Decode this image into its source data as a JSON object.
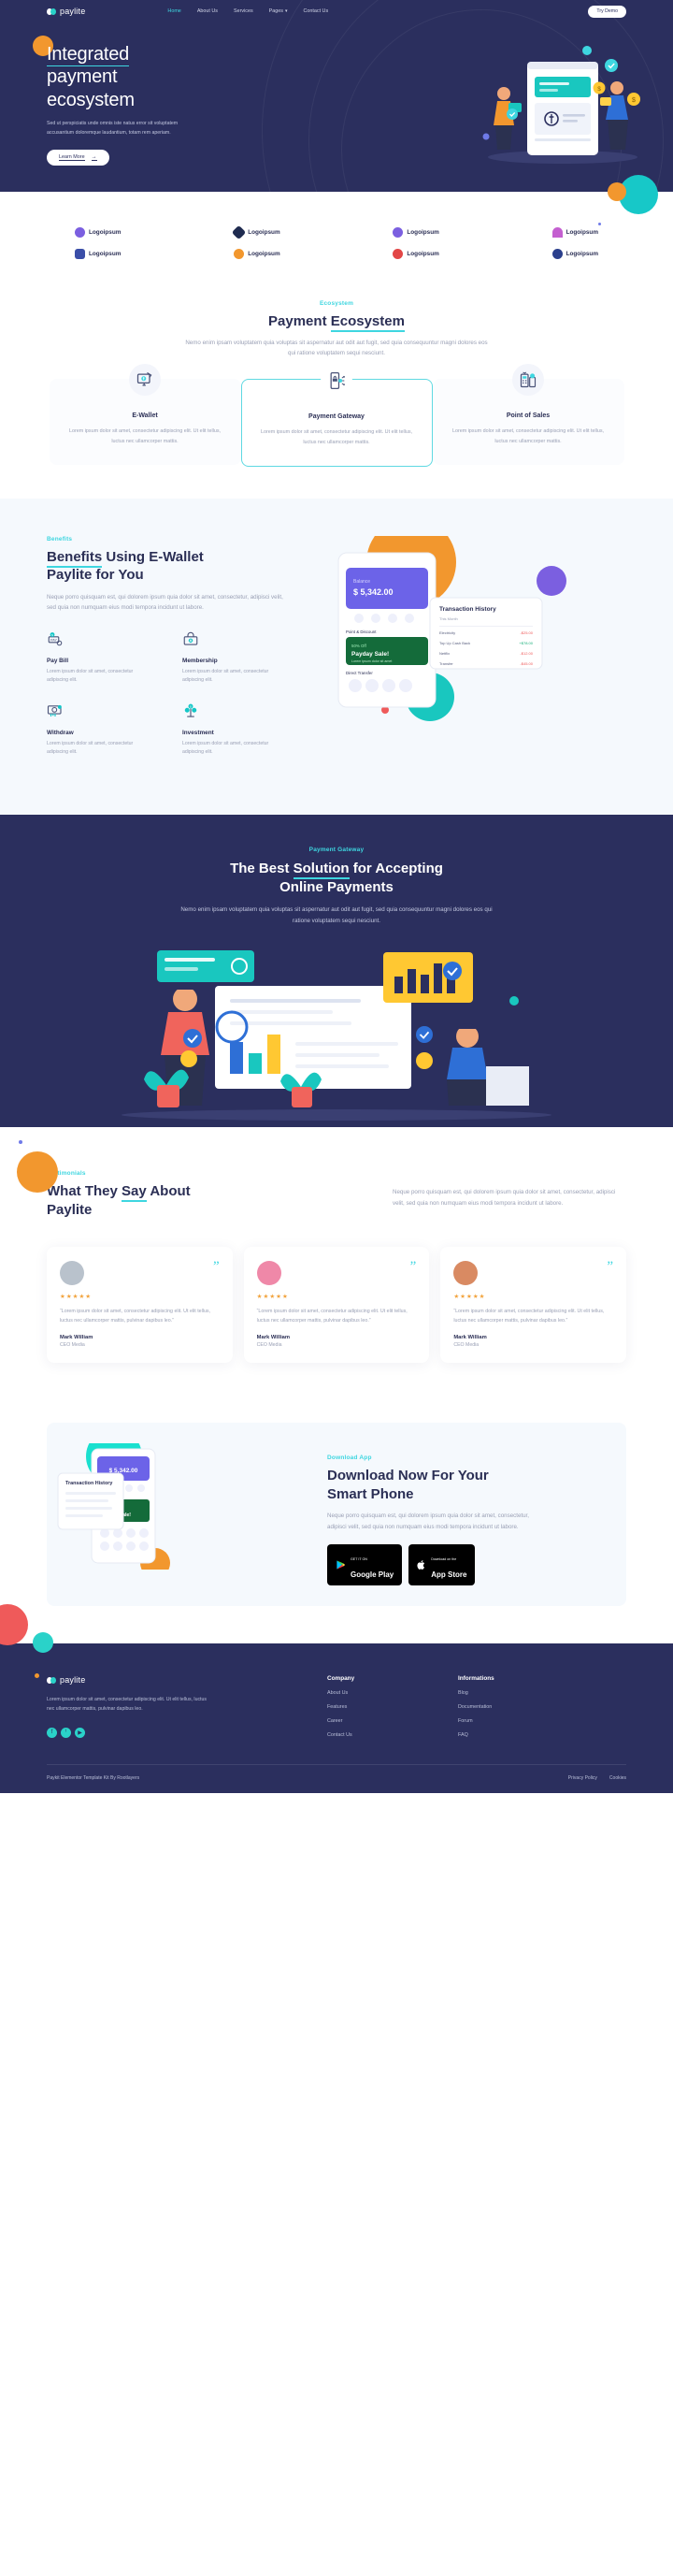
{
  "brand": {
    "name": "paylite"
  },
  "nav": {
    "items": [
      {
        "label": "Home",
        "active": true
      },
      {
        "label": "About Us",
        "active": false
      },
      {
        "label": "Services",
        "active": false
      },
      {
        "label": "Pages",
        "active": false,
        "caret": "▾"
      },
      {
        "label": "Contact Us",
        "active": false
      }
    ],
    "cta": "Try Demo"
  },
  "hero": {
    "title_line1": "Integrated",
    "title_line2": "payment",
    "title_line3": "ecosystem",
    "paragraph": "Sed ut perspiciatis unde omnis iste natus error sit voluptatem accusantium doloremque laudantium, totam rem aperiam.",
    "button": "Learn More",
    "button_arrow": "→"
  },
  "logos": {
    "row1": [
      "Logoipsum",
      "Logoipsum",
      "Logoipsum",
      "Logoipsum"
    ],
    "row2": [
      "Logoipsum",
      "Logoipsum",
      "Logoipsum",
      "Logoipsum"
    ],
    "colors1": [
      "#7b5fe0",
      "#1f2b50",
      "#7b5fe0",
      "#c45fd0"
    ],
    "colors2": [
      "#3a4ea8",
      "#f2972e",
      "#e24646",
      "#2b3f8c"
    ]
  },
  "ecosystem": {
    "eyebrow": "Ecosystem",
    "title_a": "Payment ",
    "title_b": "Ecosystem",
    "subtitle": "Nemo enim ipsam voluptatem quia voluptas sit aspernatur aut odit aut fugit, sed quia consequuntur magni dolores eos qui ratione voluptatem sequi nesciunt.",
    "cards": [
      {
        "title": "E-Wallet",
        "body": "Lorem ipsum dolor sit amet, consectetur adipiscing elit. Ut elit tellus, luctus nec ullamcorper mattis.",
        "icon": "ewallet-icon"
      },
      {
        "title": "Payment Gateway",
        "body": "Lorem ipsum dolor sit amet, consectetur adipiscing elit. Ut elit tellus, luctus nec ullamcorper mattis.",
        "icon": "payment-gateway-icon"
      },
      {
        "title": "Point of Sales",
        "body": "Lorem ipsum dolor sit amet, consectetur adipiscing elit. Ut elit tellus, luctus nec ullamcorper mattis.",
        "icon": "point-of-sales-icon"
      }
    ]
  },
  "benefits": {
    "eyebrow": "Benefits",
    "title_a": "Benefits",
    "title_b": " Using E-Wallet",
    "title_line2": "Paylite for You",
    "lead": "Neque porro quisquam est, qui dolorem ipsum quia dolor sit amet, consectetur, adipisci velit, sed quia non numquam eius modi tempora incidunt ut labore.",
    "features": [
      {
        "title": "Pay Bill",
        "body": "Lorem ipsum dolor sit amet, consectetur adipiscing elit.",
        "icon": "pay-bill-icon"
      },
      {
        "title": "Membership",
        "body": "Lorem ipsum dolor sit amet, consectetur adipiscing elit.",
        "icon": "membership-icon"
      },
      {
        "title": "Withdraw",
        "body": "Lorem ipsum dolor sit amet, consectetur adipiscing elit.",
        "icon": "withdraw-icon"
      },
      {
        "title": "Investment",
        "body": "Lorem ipsum dolor sit amet, consectetur adipiscing elit.",
        "icon": "investment-icon"
      }
    ],
    "phone": {
      "balance_label": "Balance",
      "balance_amount": "$ 5,342.00",
      "promo_title": "Payday Sale!",
      "promo_discount": "50% Off",
      "promo_sub": "Lorem ipsum dolor sit amet",
      "section_label": "Point & Discount",
      "transfer_label": "Direct Transfer"
    },
    "history": {
      "title": "Transaction History",
      "subtitle": "This Month",
      "rows": [
        {
          "name": "Electricity",
          "amount": "-$25.00"
        },
        {
          "name": "Top Up Cash Back",
          "amount": "+$78.00"
        },
        {
          "name": "Netflix",
          "amount": "-$12.00"
        },
        {
          "name": "Transfer",
          "amount": "-$45.00"
        }
      ]
    }
  },
  "gateway": {
    "eyebrow": "Payment Gateway",
    "title_a": "The Best ",
    "title_b": "Solution",
    "title_c": " for Accepting",
    "title_line2": "Online Payments",
    "subtitle": "Nemo enim ipsam voluptatem quia voluptas sit aspernatur aut odit aut fugit, sed quia consequuntur magni dolores eos qui ratione voluptatem sequi nesciunt."
  },
  "testimonials": {
    "eyebrow": "Testimonials",
    "title_a": "What They ",
    "title_b": "Say",
    "title_c": " About",
    "title_line2": "Paylite",
    "lead": "Neque porro quisquam est, qui dolorem ipsum quia dolor sit amet, consectetur, adipisci velit, sed quia non numquam eius modi tempora incidunt ut labore.",
    "quote_glyph": "”",
    "stars": "★★★★★",
    "items": [
      {
        "body": "“Lorem ipsum dolor sit amet, consectetur adipiscing elit. Ut elit tellus, luctus nec ullamcorper mattis, pulvinar dapibus leo.”",
        "name": "Mark William",
        "role": "CEO Media",
        "avatar_color": "#b9c2cc"
      },
      {
        "body": "“Lorem ipsum dolor sit amet, consectetur adipiscing elit. Ut elit tellus, luctus nec ullamcorper mattis, pulvinar dapibus leo.”",
        "name": "Mark William",
        "role": "CEO Media",
        "avatar_color": "#ef88a8"
      },
      {
        "body": "“Lorem ipsum dolor sit amet, consectetur adipiscing elit. Ut elit tellus, luctus nec ullamcorper mattis, pulvinar dapibus leo.”",
        "name": "Mark William",
        "role": "CEO Media",
        "avatar_color": "#d98a62"
      }
    ]
  },
  "download": {
    "eyebrow": "Download App",
    "title_line1": "Download Now For Your",
    "title_line2": "Smart Phone",
    "lead": "Neque porro quisquam est, qui dolorem ipsum quia dolor sit amet, consectetur, adipisci velit, sed quia non numquam eius modi tempora incidunt ut labore.",
    "google": {
      "small": "GET IT ON",
      "big": "Google Play"
    },
    "apple": {
      "small": "Download on the",
      "big": "App Store"
    },
    "phone": {
      "balance_amount": "$ 5,342.00",
      "history_title": "Transaction History"
    }
  },
  "footer": {
    "about": "Lorem ipsum dolor sit amet, consectetur adipiscing elit. Ut elit tellus, luctus nec ullamcorper mattis, pulvinar dapibus leo.",
    "socials": [
      "f",
      "ᵗ",
      "▶"
    ],
    "columns": [
      {
        "title": "Company",
        "links": [
          "About Us",
          "Features",
          "Career",
          "Contact Us"
        ]
      },
      {
        "title": "Informations",
        "links": [
          "Blog",
          "Documentation",
          "Forum",
          "FAQ"
        ]
      }
    ],
    "copyright": "Paykit Elementor Template Kit By Rootlayers",
    "legal": [
      "Privacy Policy",
      "Cookies"
    ]
  },
  "colors": {
    "navy": "#2b2f5e",
    "teal": "#3ed6e0",
    "orange": "#f2972e",
    "red": "#ef5a5a",
    "muted": "#9aa0b5"
  }
}
